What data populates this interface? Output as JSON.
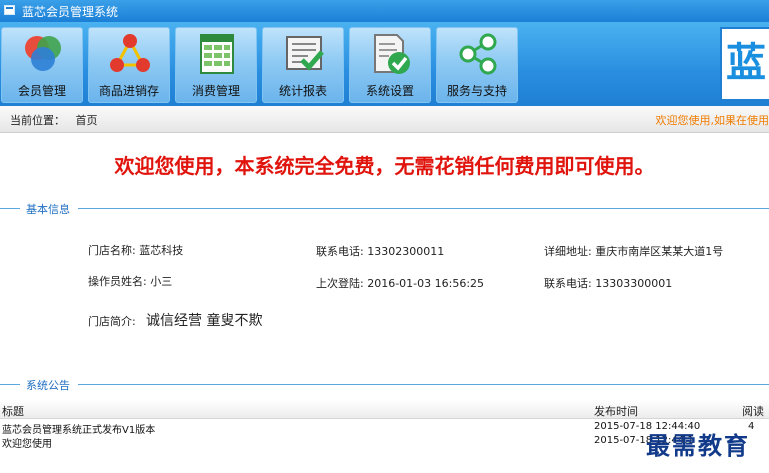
{
  "window": {
    "title": "蓝芯会员管理系统"
  },
  "toolbar": {
    "items": [
      {
        "label": "会员管理",
        "icon": "member-icon"
      },
      {
        "label": "商品进销存",
        "icon": "inventory-icon"
      },
      {
        "label": "消费管理",
        "icon": "spreadsheet-icon"
      },
      {
        "label": "统计报表",
        "icon": "report-icon"
      },
      {
        "label": "系统设置",
        "icon": "settings-doc-icon"
      },
      {
        "label": "服务与支持",
        "icon": "share-icon"
      }
    ],
    "brand_char": "蓝"
  },
  "location": {
    "label": "当前位置：",
    "value": "首页",
    "marquee": "欢迎您使用,如果在使用"
  },
  "welcome": "欢迎您使用，本系统完全免费，无需花销任何费用即可使用。",
  "basic_info": {
    "title": "基本信息",
    "store_name": "门店名称: 蓝芯科技",
    "phone": "联系电话: 13302300011",
    "address": "详细地址: 重庆市南岸区某某大道1号",
    "operator": "操作员姓名: 小三",
    "last_login": "上次登陆: 2016-01-03 16:56:25",
    "phone2": "联系电话: 13303300001",
    "intro_label": "门店简介:",
    "intro": "诚信经营 童叟不欺"
  },
  "announcements": {
    "title": "系统公告",
    "columns": {
      "title": "标题",
      "time": "发布时间",
      "reads": "阅读"
    },
    "rows": [
      {
        "title": "蓝芯会员管理系统正式发布V1版本",
        "time": "2015-07-18 12:44:40",
        "reads": "4"
      },
      {
        "title": "欢迎您使用",
        "time": "2015-07-18 12:44:1",
        "reads": ""
      }
    ]
  },
  "watermark": "最需教育",
  "colors": {
    "toolbar": "#2a8ee0",
    "welcome": "#e0140d",
    "accent": "#1f6fc1",
    "marquee": "#f07c00"
  }
}
